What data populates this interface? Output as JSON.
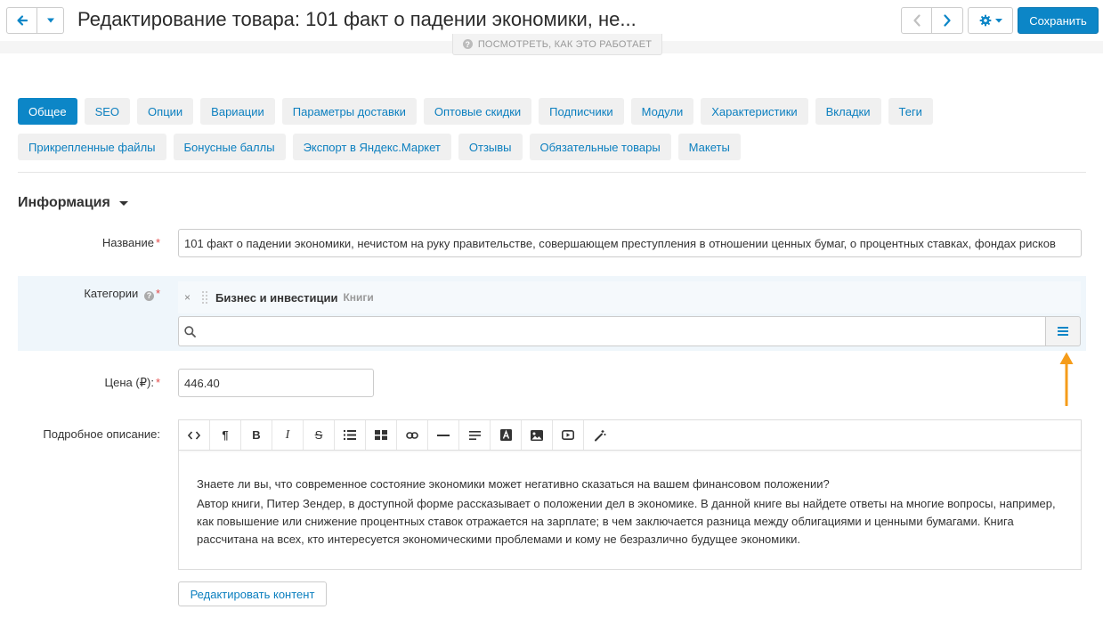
{
  "header": {
    "title": "Редактирование товара: 101 факт о падении экономики, не...",
    "save_label": "Сохранить",
    "howto_label": "Посмотреть, как это работает"
  },
  "tabs": {
    "row1": [
      "Общее",
      "SEO",
      "Опции",
      "Вариации",
      "Параметры доставки",
      "Оптовые скидки",
      "Подписчики",
      "Модули",
      "Характеристики",
      "Вкладки",
      "Теги"
    ],
    "row2": [
      "Прикрепленные файлы",
      "Бонусные баллы",
      "Экспорт в Яндекс.Маркет",
      "Отзывы",
      "Обязательные товары",
      "Макеты"
    ],
    "active": "Общее"
  },
  "section": {
    "title": "Информация"
  },
  "form": {
    "name_label": "Название",
    "name_value": "101 факт о падении экономики, нечистом на руку правительстве, совершающем преступления в отношении ценных бумаг, о процентных ставках, фондах рисков",
    "categories_label": "Категории",
    "category_name": "Бизнес и инвестиции",
    "category_parent": "Книги",
    "price_label": "Цена (₽):",
    "price_value": "446.40",
    "description_label": "Подробное описание:",
    "description_paragraphs": [
      "Знаете ли вы, что современное состояние экономики может негативно сказаться на вашем финансовом положении?",
      "Автор книги, Питер Зендер, в доступной форме рассказывает о положении дел в экономике. В данной книге вы найдете ответы на многие вопросы, например, как повышение или снижение процентных ставок отражается на зарплате; в чем заключается разница между облигациями и ценными бумагами. Книга рассчитана на всех, кто интересуется экономическими проблемами и кому не безразлично будущее экономики."
    ],
    "edit_content_label": "Редактировать контент"
  },
  "colors": {
    "accent": "#0c86c7",
    "link": "#0b7fbf",
    "required": "#e34b4b",
    "arrow": "#f59c1a"
  }
}
